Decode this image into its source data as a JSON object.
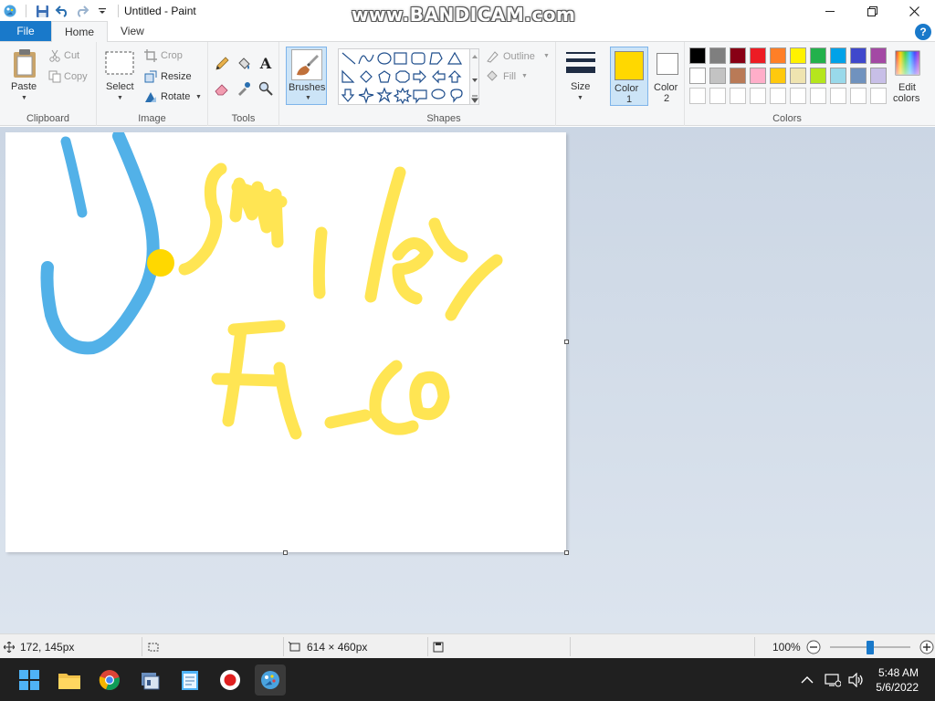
{
  "window": {
    "title": "Untitled - Paint",
    "watermark": "www.BANDICAM.com"
  },
  "tabs": {
    "file": "File",
    "home": "Home",
    "view": "View",
    "help": "?"
  },
  "ribbon": {
    "clipboard": {
      "label": "Clipboard",
      "paste": "Paste",
      "cut": "Cut",
      "copy": "Copy"
    },
    "image": {
      "label": "Image",
      "select": "Select",
      "crop": "Crop",
      "resize": "Resize",
      "rotate": "Rotate"
    },
    "tools": {
      "label": "Tools",
      "text_icon": "A"
    },
    "brushes": {
      "label": "Brushes"
    },
    "shapes": {
      "label": "Shapes",
      "outline": "Outline",
      "fill": "Fill"
    },
    "size": {
      "label": "Size"
    },
    "color1": {
      "label_line1": "Color",
      "label_line2": "1",
      "value": "#ffd800"
    },
    "color2": {
      "label_line1": "Color",
      "label_line2": "2",
      "value": "#ffffff"
    },
    "colors": {
      "label": "Colors",
      "row1": [
        "#000000",
        "#7f7f7f",
        "#880015",
        "#ed1c24",
        "#ff7f27",
        "#fff200",
        "#22b14c",
        "#00a2e8",
        "#3f48cc",
        "#a349a4"
      ],
      "row2": [
        "#ffffff",
        "#c3c3c3",
        "#b97a57",
        "#ffaec9",
        "#ffc90e",
        "#efe4b0",
        "#b5e61d",
        "#99d9ea",
        "#7092be",
        "#c8bfe7"
      ]
    },
    "edit_colors": {
      "line1": "Edit",
      "line2": "colors"
    }
  },
  "canvas": {
    "background": "#ffffff",
    "text_drawn": "Smiley FT_Co"
  },
  "statusbar": {
    "cursor_position": "172, 145px",
    "image_size": "614 × 460px",
    "zoom": "100%",
    "zoom_slider_level": 0.5
  },
  "taskbar": {
    "time": "5:48 AM",
    "date": "5/6/2022",
    "apps": [
      "start-icon",
      "file-explorer-icon",
      "chrome-icon",
      "app-icon",
      "notepad-icon",
      "record-icon",
      "paint-icon"
    ]
  }
}
